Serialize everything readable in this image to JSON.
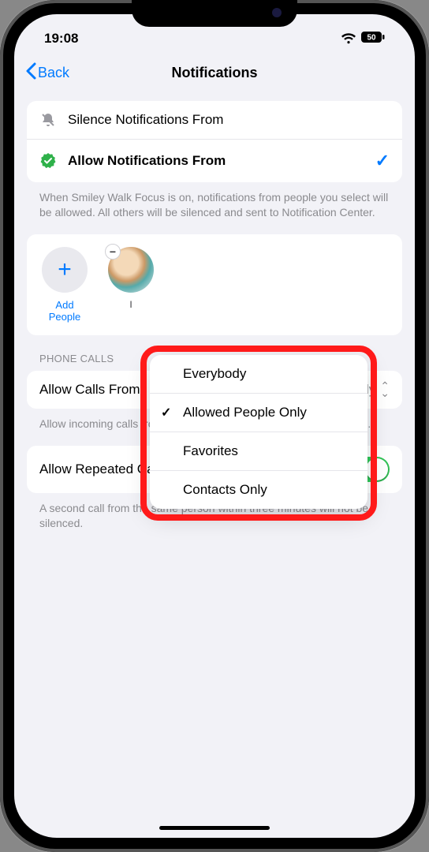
{
  "status": {
    "time": "19:08",
    "battery": "50"
  },
  "nav": {
    "back": "Back",
    "title": "Notifications"
  },
  "modes": {
    "silence": "Silence Notifications From",
    "allow": "Allow Notifications From",
    "footer": "When Smiley Walk Focus is on, notifications from people you select will be allowed. All others will be silenced and sent to Notification Center."
  },
  "people": {
    "add": "Add People",
    "person1_initial": "I"
  },
  "phone": {
    "section": "PHONE CALLS",
    "allow_row": "Allow Calls From",
    "allow_value": "Allowed People Only",
    "allow_footer": "Allow incoming calls from only the contacts you added to the Focus.",
    "repeated": "Allow Repeated Calls",
    "repeated_footer": "A second call from the same person within three minutes will not be silenced."
  },
  "popover": {
    "options": [
      "Everybody",
      "Allowed People Only",
      "Favorites",
      "Contacts Only"
    ],
    "selected_index": 1
  }
}
